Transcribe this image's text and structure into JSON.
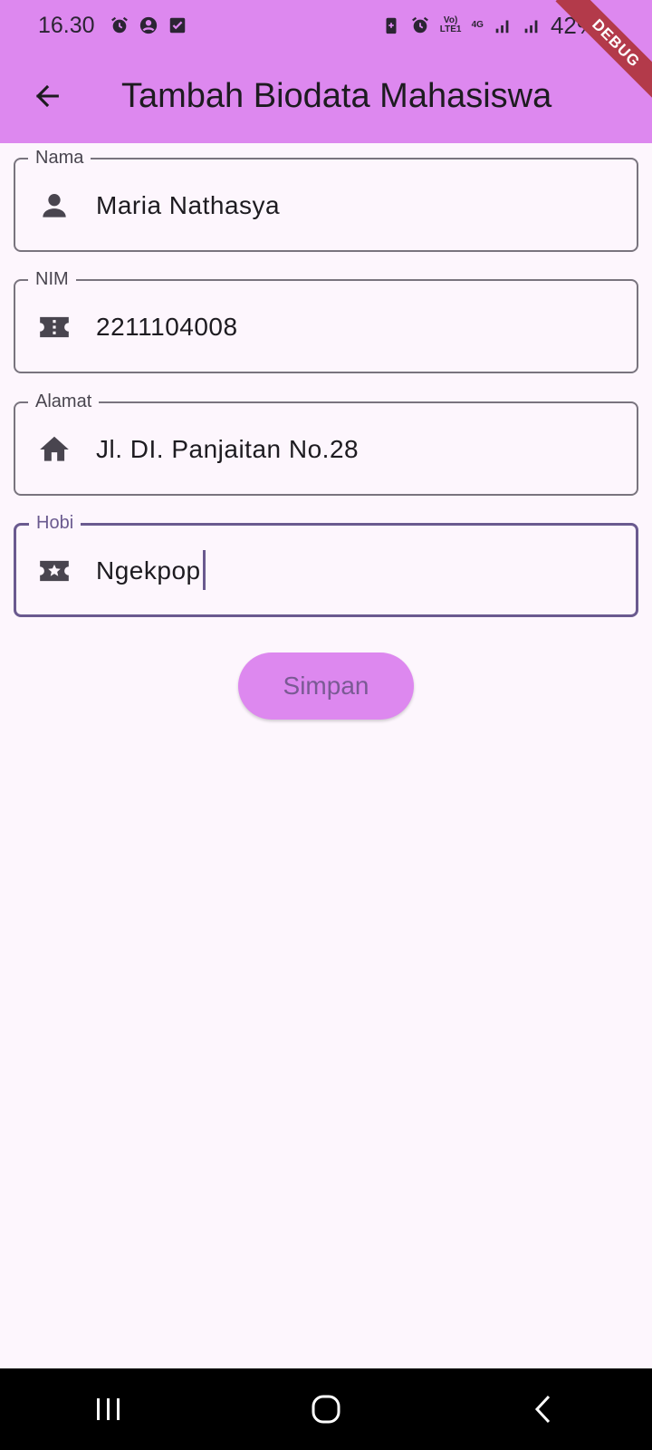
{
  "status_bar": {
    "time": "16.30",
    "left_icons": [
      "alarm-icon",
      "account-circle-icon",
      "check-box-icon"
    ],
    "right_icons": [
      "battery-saver-icon",
      "alarm-icon",
      "volte-icon",
      "4g-icon",
      "signal-icon",
      "signal-icon"
    ],
    "volte_label": "Vo) LTE1",
    "network_label": "4G",
    "battery": "42%"
  },
  "debug_banner": "DEBUG",
  "app_bar": {
    "back_icon": "arrow-back-icon",
    "title": "Tambah Biodata Mahasiswa",
    "background": "#dd88ef"
  },
  "form": {
    "fields": [
      {
        "label": "Nama",
        "value": "Maria Nathasya",
        "icon": "person-icon"
      },
      {
        "label": "NIM",
        "value": "2211104008",
        "icon": "badge-icon"
      },
      {
        "label": "Alamat",
        "value": "Jl. DI. Panjaitan No.28",
        "icon": "home-icon"
      },
      {
        "label": "Hobi",
        "value": "Ngekpop",
        "icon": "star-ticket-icon",
        "focused": true
      }
    ],
    "submit_label": "Simpan"
  },
  "nav_bar": {
    "buttons": [
      "recent-apps-icon",
      "home-button-icon",
      "back-nav-icon"
    ]
  },
  "colors": {
    "accent": "#dd88ef",
    "focus_border": "#6a5a8f",
    "background": "#fdf6fd"
  }
}
